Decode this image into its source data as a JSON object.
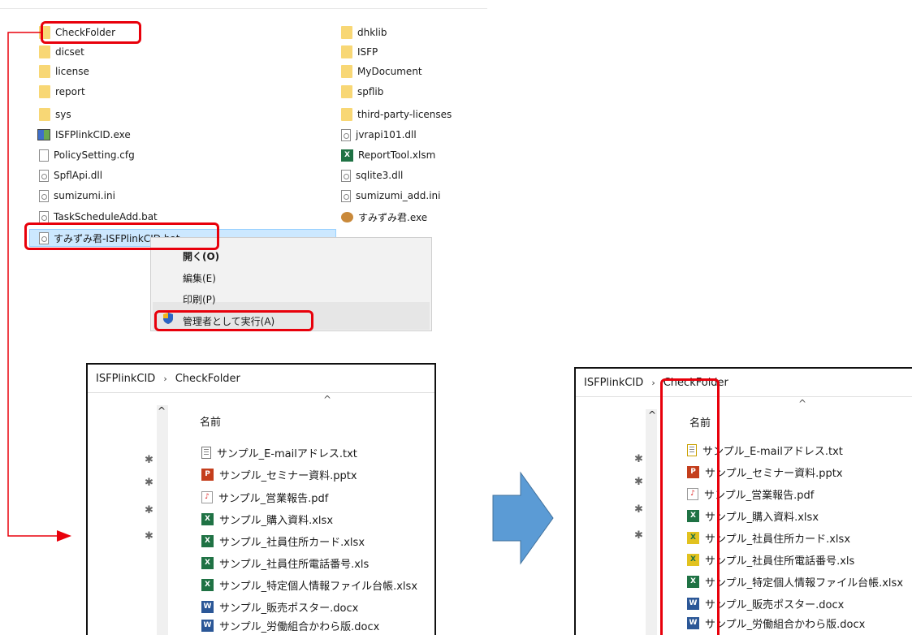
{
  "explorer": {
    "left_column": [
      {
        "name": "CheckFolder",
        "icon": "folder-icon"
      },
      {
        "name": "dicset",
        "icon": "folder-icon"
      },
      {
        "name": "license",
        "icon": "folder-icon"
      },
      {
        "name": "report",
        "icon": "folder-icon"
      },
      {
        "name": "sys",
        "icon": "folder-icon"
      },
      {
        "name": "ISFPlinkCID.exe",
        "icon": "exe-icon"
      },
      {
        "name": "PolicySetting.cfg",
        "icon": "file-icon"
      },
      {
        "name": "SpflApi.dll",
        "icon": "dll-icon"
      },
      {
        "name": "sumizumi.ini",
        "icon": "ini-icon"
      },
      {
        "name": "TaskScheduleAdd.bat",
        "icon": "bat-icon"
      },
      {
        "name": "すみずみ君-ISFPlinkCID.bat",
        "icon": "bat-icon"
      }
    ],
    "right_column": [
      {
        "name": "dhklib",
        "icon": "folder-icon"
      },
      {
        "name": "ISFP",
        "icon": "folder-icon"
      },
      {
        "name": "MyDocument",
        "icon": "folder-icon"
      },
      {
        "name": "spflib",
        "icon": "folder-icon"
      },
      {
        "name": "third-party-licenses",
        "icon": "folder-icon"
      },
      {
        "name": "jvrapi101.dll",
        "icon": "dll-icon"
      },
      {
        "name": "ReportTool.xlsm",
        "icon": "excel-icon"
      },
      {
        "name": "sqlite3.dll",
        "icon": "dll-icon"
      },
      {
        "name": "sumizumi_add.ini",
        "icon": "ini-icon"
      },
      {
        "name": "すみずみ君.exe",
        "icon": "app-icon"
      }
    ]
  },
  "context_menu": {
    "items": [
      "開く(O)",
      "編集(E)",
      "印刷(P)",
      "管理者として実行(A)"
    ],
    "highlight_color": "#e8000b"
  },
  "panel_before": {
    "breadcrumb": [
      "ISFPlinkCID",
      "CheckFolder"
    ],
    "column_header": "名前",
    "files": [
      {
        "name": "サンプル_E-mailアドレス.txt",
        "icon": "txt-icon"
      },
      {
        "name": "サンプル_セミナー資料.pptx",
        "icon": "ppt-icon"
      },
      {
        "name": "サンプル_営業報告.pdf",
        "icon": "pdf-icon"
      },
      {
        "name": "サンプル_購入資料.xlsx",
        "icon": "excel-icon"
      },
      {
        "name": "サンプル_社員住所カード.xlsx",
        "icon": "excel-icon"
      },
      {
        "name": "サンプル_社員住所電話番号.xls",
        "icon": "excel-icon"
      },
      {
        "name": "サンプル_特定個人情報ファイル台帳.xlsx",
        "icon": "excel-icon"
      },
      {
        "name": "サンプル_販売ポスター.docx",
        "icon": "word-icon"
      },
      {
        "name": "サンプル_労働組合かわら版.docx",
        "icon": "word-icon"
      }
    ]
  },
  "panel_after": {
    "breadcrumb": [
      "ISFPlinkCID",
      "CheckFolder"
    ],
    "column_header": "名前",
    "files": [
      {
        "name": "サンプル_E-mailアドレス.txt",
        "icon": "txt-icon-marked"
      },
      {
        "name": "サンプル_セミナー資料.pptx",
        "icon": "ppt-icon"
      },
      {
        "name": "サンプル_営業報告.pdf",
        "icon": "pdf-icon"
      },
      {
        "name": "サンプル_購入資料.xlsx",
        "icon": "excel-icon"
      },
      {
        "name": "サンプル_社員住所カード.xlsx",
        "icon": "excel-icon-marked"
      },
      {
        "name": "サンプル_社員住所電話番号.xls",
        "icon": "excel-icon-marked"
      },
      {
        "name": "サンプル_特定個人情報ファイル台帳.xlsx",
        "icon": "excel-icon"
      },
      {
        "name": "サンプル_販売ポスター.docx",
        "icon": "word-icon"
      },
      {
        "name": "サンプル_労働組合かわら版.docx",
        "icon": "word-icon"
      }
    ]
  },
  "arrow_color": "#5b9bd5"
}
